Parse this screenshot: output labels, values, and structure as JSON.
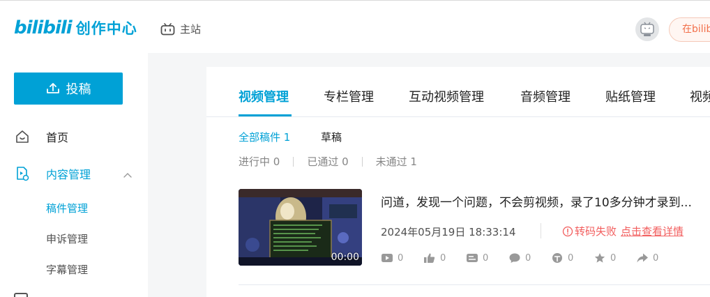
{
  "header": {
    "logo_mark": "bilibili",
    "logo_text": "创作中心",
    "main_site": "主站",
    "upload_pill": "在bilibili"
  },
  "sidebar": {
    "upload_button": "投稿",
    "home": "首页",
    "content_manage": "内容管理",
    "sub_items": [
      "稿件管理",
      "申诉管理",
      "字幕管理"
    ]
  },
  "tabs": [
    "视频管理",
    "专栏管理",
    "互动视频管理",
    "音频管理",
    "贴纸管理",
    "视频"
  ],
  "filters": {
    "all": "全部稿件 1",
    "draft": "草稿"
  },
  "status": {
    "in_progress": "进行中 0",
    "passed": "已通过 0",
    "rejected": "未通过 1"
  },
  "video": {
    "title": "问道，发现一个问题，不会剪视频，录了10多分钟才录到...",
    "date": "2024年05月19日 18:33:14",
    "duration": "00:00",
    "fail_text": "转码失败",
    "fail_link": "点击查看详情",
    "stats": {
      "plays": "0",
      "likes": "0",
      "danmaku": "0",
      "comments": "0",
      "coins": "0",
      "favorites": "0",
      "shares": "0"
    }
  },
  "colors": {
    "accent": "#00a1d6",
    "error": "#f25d5d",
    "upload_pill_text": "#f26f4a"
  }
}
